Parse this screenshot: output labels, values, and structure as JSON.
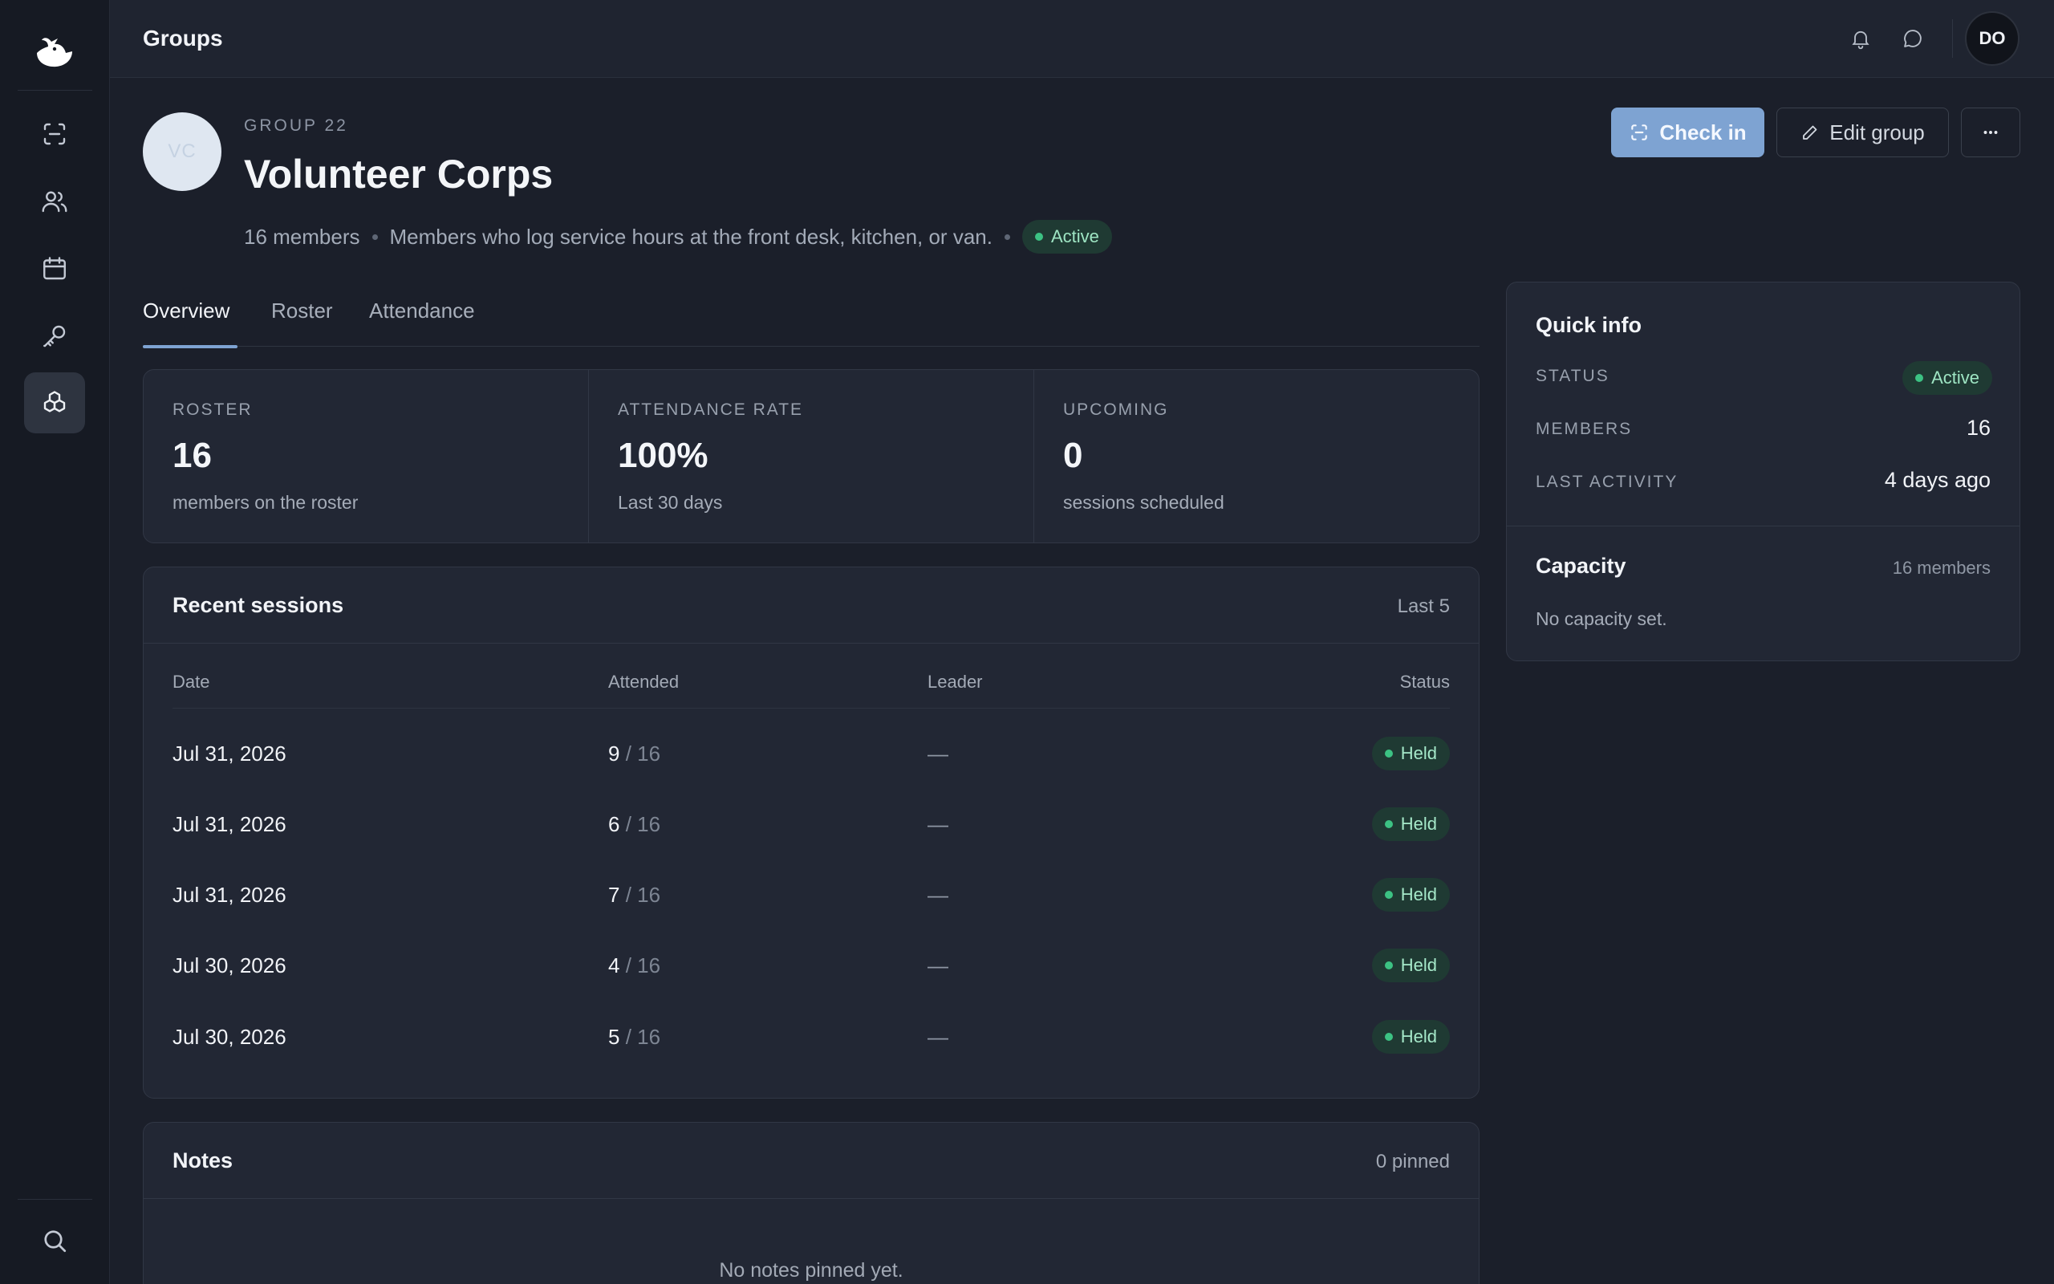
{
  "topbar": {
    "title": "Groups",
    "user_initials": "DO"
  },
  "group": {
    "initials": "VC",
    "kicker": "GROUP 22",
    "name": "Volunteer Corps",
    "member_count": "16 members",
    "description": "Members who log service hours at the front desk, kitchen, or van.",
    "status": "Active"
  },
  "actions": {
    "check_in": "Check in",
    "edit": "Edit group"
  },
  "tabs": [
    {
      "label": "Overview",
      "active": true
    },
    {
      "label": "Roster",
      "active": false
    },
    {
      "label": "Attendance",
      "active": false
    }
  ],
  "stats": [
    {
      "label": "ROSTER",
      "value": "16",
      "sub": "members on the roster"
    },
    {
      "label": "ATTENDANCE RATE",
      "value": "100%",
      "sub": "Last 30 days"
    },
    {
      "label": "UPCOMING",
      "value": "0",
      "sub": "sessions scheduled"
    }
  ],
  "sessions": {
    "title": "Recent sessions",
    "aside": "Last 5",
    "columns": [
      "Date",
      "Attended",
      "Leader",
      "Status"
    ],
    "rows": [
      {
        "date": "Jul 31, 2026",
        "attended": "9",
        "total": "/ 16",
        "leader": "—",
        "status": "Held"
      },
      {
        "date": "Jul 31, 2026",
        "attended": "6",
        "total": "/ 16",
        "leader": "—",
        "status": "Held"
      },
      {
        "date": "Jul 31, 2026",
        "attended": "7",
        "total": "/ 16",
        "leader": "—",
        "status": "Held"
      },
      {
        "date": "Jul 30, 2026",
        "attended": "4",
        "total": "/ 16",
        "leader": "—",
        "status": "Held"
      },
      {
        "date": "Jul 30, 2026",
        "attended": "5",
        "total": "/ 16",
        "leader": "—",
        "status": "Held"
      }
    ]
  },
  "notes": {
    "title": "Notes",
    "aside": "0 pinned",
    "empty": "No notes pinned yet."
  },
  "quick_info": {
    "title": "Quick info",
    "status_label": "STATUS",
    "status_value": "Active",
    "members_label": "MEMBERS",
    "members_value": "16",
    "activity_label": "LAST ACTIVITY",
    "activity_value": "4 days ago"
  },
  "capacity": {
    "title": "Capacity",
    "aside": "16 members",
    "text": "No capacity set."
  },
  "colors": {
    "accent": "#7ea3d2",
    "success": "#3cc283",
    "background": "#1b1f2a"
  }
}
